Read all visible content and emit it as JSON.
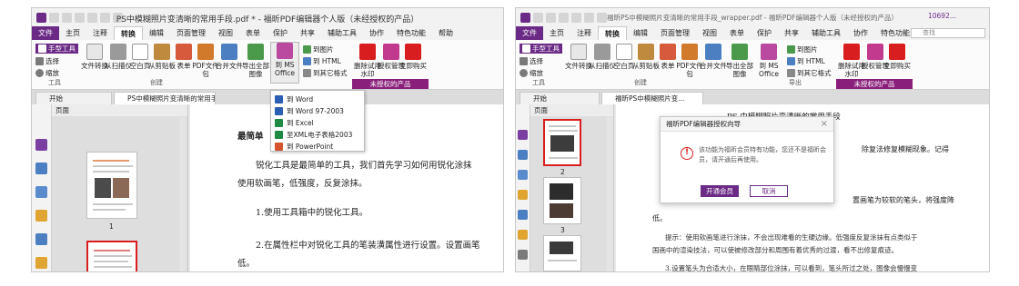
{
  "left": {
    "title": "PS中模糊照片变清晰的常用手段.pdf * - 福昕PDF编辑器个人版（未经授权的产品）",
    "menu": [
      "文件",
      "主页",
      "注释",
      "转换",
      "编辑",
      "页面管理",
      "视图",
      "表单",
      "保护",
      "共享",
      "辅助工具",
      "协作",
      "特色功能",
      "帮助"
    ],
    "tools": {
      "hand": "手型工具",
      "select": "选择",
      "zoom": "缩放",
      "group": "工具"
    },
    "ribbon": {
      "file_convert": "文件转换",
      "from_scanner": "从扫描仪",
      "blank": "空白页",
      "from_clipboard": "从剪贴板",
      "form": "表单",
      "pdf_package": "PDF文件包",
      "merge": "合并文件",
      "create_group": "创建",
      "export_all_images": "导出全部图像",
      "to_ms_office": "到 MS Office",
      "to_image": "到图片",
      "to_html": "到 HTML",
      "to_other": "到其它格式",
      "remove_watermark": "删除试用水印",
      "license_mgmt": "授权管理",
      "buy_now": "立即购买",
      "unauth": "未授权的产品"
    },
    "dropdown": [
      "到 Word",
      "到 Word 97-2003",
      "到 Excel",
      "至XML电子表格2003",
      "到 PowerPoint"
    ],
    "tabs": {
      "start": "开始",
      "doc": "PS中模糊照片变清晰的常用手..."
    },
    "page_panel": "页面",
    "page_numbers": [
      "1"
    ],
    "doc_text": {
      "heading": "最简单",
      "p1a": "锐化工具是最简单的工具，我们首先学习如何用锐化涂抹",
      "p1b": "使用软画笔，低强度，反复涂抹。",
      "p2": "1.使用工具箱中的锐化工具。",
      "p3a": "2.在属性栏中对锐化工具的笔装潢属性进行设置。设置画笔",
      "p3b": "低。"
    }
  },
  "right": {
    "title": "福昕PS中模糊照片变清晰的常用手段_wrapper.pdf - 福昕PDF编辑器个人版（未经授权的产品）",
    "user_id": "10692...",
    "search_placeholder": "查找",
    "menu": [
      "文件",
      "主页",
      "注释",
      "转换",
      "编辑",
      "页面管理",
      "视图",
      "表单",
      "保护",
      "共享",
      "辅助工具",
      "协作",
      "特色功能",
      "帮助"
    ],
    "tools": {
      "hand": "手型工具",
      "select": "选择",
      "zoom": "缩放",
      "group": "工具"
    },
    "ribbon": {
      "file_convert": "文件转换",
      "from_scanner": "从扫描仪",
      "blank": "空白页",
      "from_clipboard": "从剪贴板",
      "form": "表单",
      "pdf_package": "PDF文件包",
      "merge": "合并文件",
      "create_group": "创建",
      "export_all_images": "导出全部图像",
      "to_ms_office": "到 MS Office",
      "to_image": "到图片",
      "to_html": "到 HTML",
      "to_other": "到其它格式",
      "export_group": "导出",
      "remove_watermark": "删除试用水印",
      "license_mgmt": "授权管理",
      "buy_now": "立即购买",
      "unauth": "未授权的产品"
    },
    "tabs": {
      "start": "开始",
      "doc": "福昕PS中模糊照片变..."
    },
    "page_panel": "页面",
    "page_numbers": [
      "2",
      "3"
    ],
    "doc_text": {
      "title": "PS 中模糊照片变清晰的常用手段",
      "r1": "除复法修复模糊现象。记得",
      "r2": "置画笔为较软的笔头，将强度降",
      "r3": "低。",
      "tip1": "提示：使用软画笔进行涂抹，不会出现难看的生硬边缘。低强度反复涂抹有点类似于",
      "tip2": "国画中的渲染技法，可以使被修改部分和周围有着优秀的过渡，看不出修复痕迹。",
      "p3": "3.设置笔头为合适大小，在眼睛部位涂抹，可以看到，笔头所过之处，图像会慢慢变"
    },
    "dialog": {
      "title": "福昕PDF编辑器授权向导",
      "message1": "该功能为福昕会员特有功能，您还不是福昕会",
      "message2": "员，请开通后再使用。",
      "primary": "开通会员",
      "cancel": "取消"
    }
  },
  "colors": {
    "brand": "#6b2a86",
    "unauth": "#8a1f7b",
    "alert": "#d81e1e"
  }
}
